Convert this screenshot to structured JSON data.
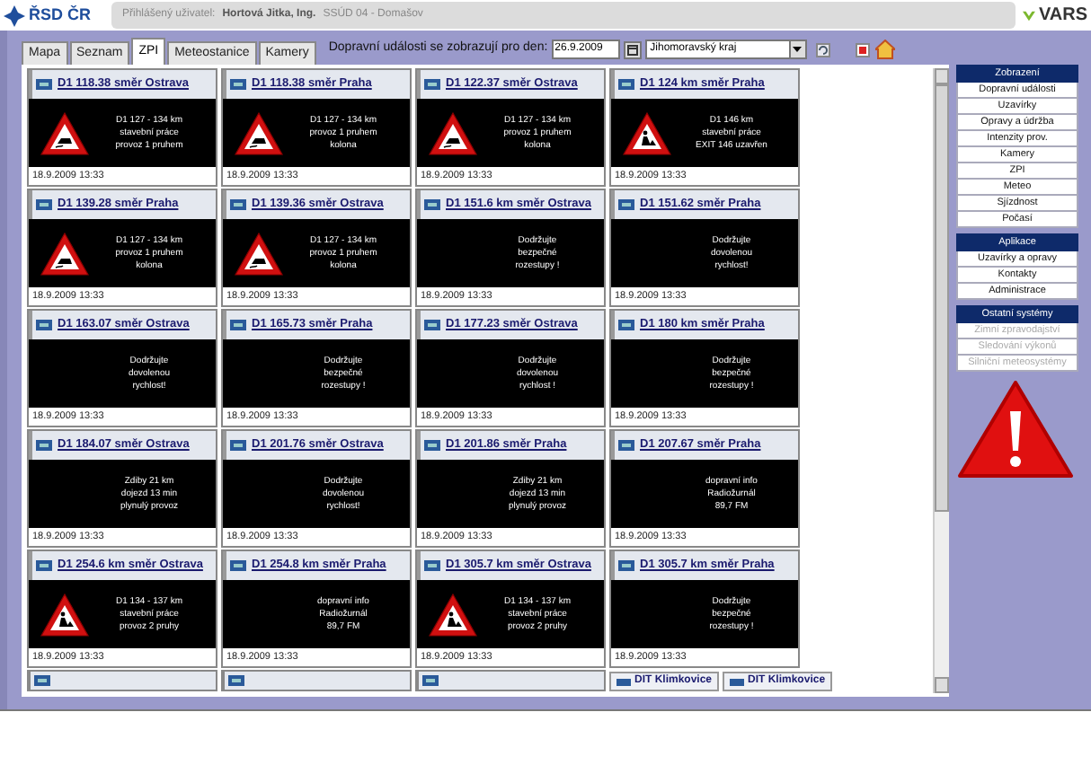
{
  "header": {
    "logo": "ŘSD ČR",
    "user_label": "Přihlášený uživatel:",
    "user_name": "Hortová Jitka, Ing.",
    "unit": "SSÚD 04 - Domašov",
    "brand": "VARS"
  },
  "tabs": [
    {
      "label": "Mapa",
      "selected": false
    },
    {
      "label": "Seznam",
      "selected": false
    },
    {
      "label": "ZPI",
      "selected": true
    },
    {
      "label": "Meteostanice",
      "selected": false
    },
    {
      "label": "Kamery",
      "selected": false
    }
  ],
  "toolbar": {
    "date_label": "Dopravní události se zobrazují pro den:",
    "date": "26.9.2009",
    "region": "Jihomoravský kraj"
  },
  "cards": [
    {
      "title": "D1 118.38 směr Ostrava",
      "kind": "skid",
      "lines": [
        "D1 127 - 134 km",
        "stavební práce",
        "provoz 1 pruhem"
      ],
      "date": "18.9.2009 13:33"
    },
    {
      "title": "D1 118.38 směr Praha",
      "kind": "skid",
      "lines": [
        "D1 127 - 134 km",
        "provoz 1 pruhem",
        "kolona"
      ],
      "date": "18.9.2009 13:33"
    },
    {
      "title": "D1 122.37 směr Ostrava",
      "kind": "skid",
      "lines": [
        "D1 127 - 134 km",
        "provoz 1 pruhem",
        "kolona"
      ],
      "date": "18.9.2009 13:33"
    },
    {
      "title": "D1 124 km směr Praha",
      "kind": "roadwork",
      "lines": [
        "D1 146 km",
        "stavební práce",
        "EXIT 146 uzavřen"
      ],
      "date": "18.9.2009 13:33"
    },
    {
      "title": "D1 139.28 směr Praha",
      "kind": "skid",
      "lines": [
        "D1 127 - 134 km",
        "provoz 1 pruhem",
        "kolona"
      ],
      "date": "18.9.2009 13:33"
    },
    {
      "title": "D1 139.36 směr Ostrava",
      "kind": "skid",
      "lines": [
        "D1 127 - 134 km",
        "provoz 1 pruhem",
        "kolona"
      ],
      "date": "18.9.2009 13:33"
    },
    {
      "title": "D1 151.6 km směr Ostrava",
      "kind": "text",
      "lines": [
        "Dodržujte",
        "bezpečné",
        "rozestupy !"
      ],
      "date": "18.9.2009 13:33"
    },
    {
      "title": "D1 151.62 směr Praha",
      "kind": "text",
      "lines": [
        "Dodržujte",
        "dovolenou",
        "rychlost!"
      ],
      "date": "18.9.2009 13:33"
    },
    {
      "title": "D1 163.07 směr Ostrava",
      "kind": "text",
      "lines": [
        "Dodržujte",
        "dovolenou",
        "rychlost!"
      ],
      "date": "18.9.2009 13:33"
    },
    {
      "title": "D1 165.73 směr Praha",
      "kind": "text",
      "lines": [
        "Dodržujte",
        "bezpečné",
        "rozestupy !"
      ],
      "date": "18.9.2009 13:33"
    },
    {
      "title": "D1 177.23 směr Ostrava",
      "kind": "text",
      "lines": [
        "Dodržujte",
        "dovolenou",
        "rychlost !"
      ],
      "date": "18.9.2009 13:33"
    },
    {
      "title": "D1 180 km směr Praha",
      "kind": "text",
      "lines": [
        "Dodržujte",
        "bezpečné",
        "rozestupy !"
      ],
      "date": "18.9.2009 13:33"
    },
    {
      "title": "D1 184.07 směr Ostrava",
      "kind": "text",
      "lines": [
        "Zdiby 21 km",
        "dojezd 13 min",
        "plynulý provoz"
      ],
      "date": "18.9.2009 13:33"
    },
    {
      "title": "D1 201.76 směr Ostrava",
      "kind": "text",
      "lines": [
        "Dodržujte",
        "dovolenou",
        "rychlost!"
      ],
      "date": "18.9.2009 13:33"
    },
    {
      "title": "D1 201.86 směr Praha",
      "kind": "text",
      "lines": [
        "Zdiby 21 km",
        "dojezd 13 min",
        "plynulý provoz"
      ],
      "date": "18.9.2009 13:33"
    },
    {
      "title": "D1 207.67 směr Praha",
      "kind": "text",
      "lines": [
        "dopravní info",
        "Radiožurnál",
        "89,7 FM"
      ],
      "date": "18.9.2009 13:33"
    },
    {
      "title": "D1 254.6 km směr Ostrava",
      "kind": "roadwork",
      "lines": [
        "D1 134 - 137 km",
        "stavební práce",
        "provoz 2 pruhy"
      ],
      "date": "18.9.2009 13:33"
    },
    {
      "title": "D1 254.8 km směr Praha",
      "kind": "text",
      "lines": [
        "dopravní info",
        "Radiožurnál",
        "89,7 FM"
      ],
      "date": "18.9.2009 13:33"
    },
    {
      "title": "D1 305.7 km směr Ostrava",
      "kind": "roadwork",
      "lines": [
        "D1 134 - 137 km",
        "stavební práce",
        "provoz 2 pruhy"
      ],
      "date": "18.9.2009 13:33"
    },
    {
      "title": "D1 305.7 km směr Praha",
      "kind": "text",
      "lines": [
        "Dodržujte",
        "bezpečné",
        "rozestupy !"
      ],
      "date": "18.9.2009 13:33"
    }
  ],
  "partial_row": [
    {
      "kind": "stub"
    },
    {
      "kind": "stub"
    },
    {
      "kind": "stub"
    },
    {
      "kind": "tabs",
      "buttons": [
        "DIT Klimkovice",
        "DIT Klimkovice"
      ]
    }
  ],
  "sidebar": [
    {
      "heading": "Zobrazení",
      "items": [
        {
          "label": "Dopravní události",
          "disabled": false
        },
        {
          "label": "Uzavírky",
          "disabled": false
        },
        {
          "label": "Opravy a údržba",
          "disabled": false
        },
        {
          "label": "Intenzity prov.",
          "disabled": false
        },
        {
          "label": "Kamery",
          "disabled": false
        },
        {
          "label": "ZPI",
          "disabled": false
        },
        {
          "label": "Meteo",
          "disabled": false
        },
        {
          "label": "Sjízdnost",
          "disabled": false
        },
        {
          "label": "Počasí",
          "disabled": false
        }
      ]
    },
    {
      "heading": "Aplikace",
      "items": [
        {
          "label": "Uzavírky a opravy",
          "disabled": false
        },
        {
          "label": "Kontakty",
          "disabled": false
        },
        {
          "label": "Administrace",
          "disabled": false
        }
      ]
    },
    {
      "heading": "Ostatní systémy",
      "items": [
        {
          "label": "Zimní zpravodajství",
          "disabled": true
        },
        {
          "label": "Sledování výkonů",
          "disabled": true
        },
        {
          "label": "Silniční meteosystémy",
          "disabled": true
        }
      ]
    }
  ]
}
